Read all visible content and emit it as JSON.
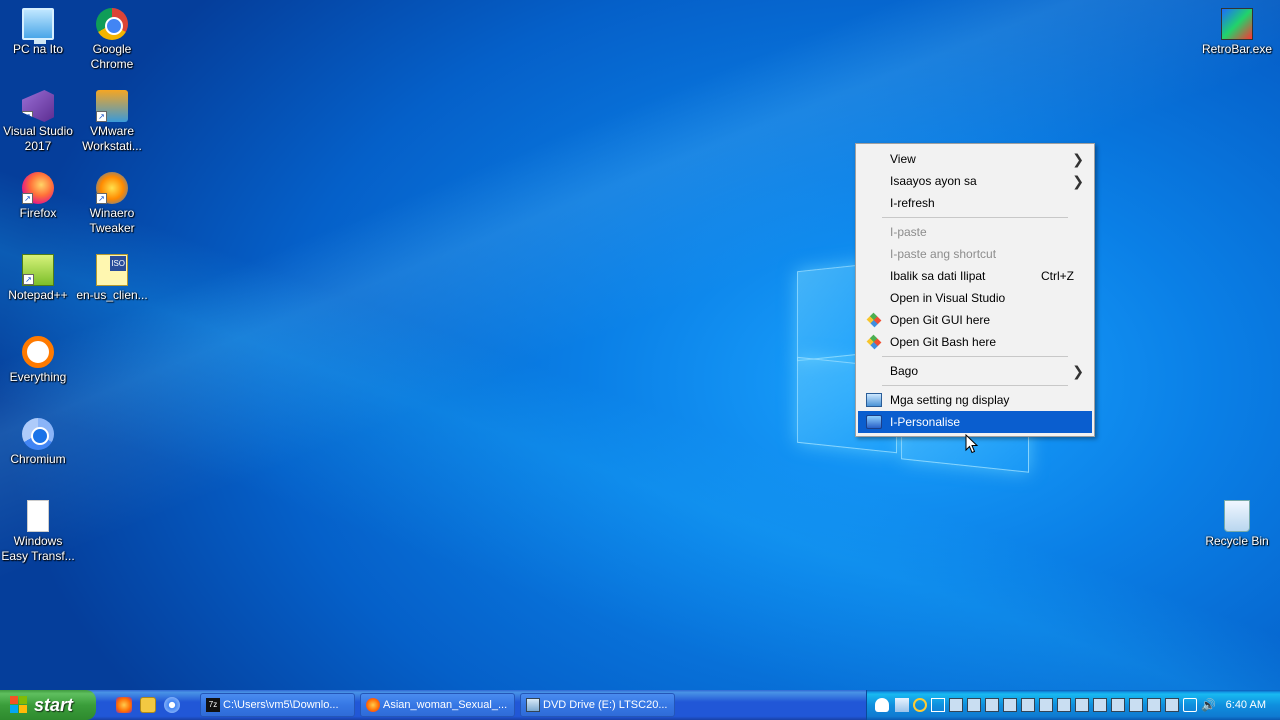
{
  "desktop": {
    "icons_left": [
      {
        "label": "PC na Ito",
        "icon": "computer-icon"
      },
      {
        "label": "Google Chrome",
        "icon": "chrome-icon"
      },
      {
        "label": "Visual Studio 2017",
        "icon": "visual-studio-icon"
      },
      {
        "label": "VMware Workstati...",
        "icon": "vmware-icon"
      },
      {
        "label": "Firefox",
        "icon": "firefox-icon"
      },
      {
        "label": "Winaero Tweaker",
        "icon": "winaero-icon"
      },
      {
        "label": "Notepad++",
        "icon": "notepadpp-icon"
      },
      {
        "label": "en-us_clien...",
        "icon": "iso-file-icon"
      },
      {
        "label": "Everything",
        "icon": "everything-icon"
      },
      {
        "label": "Chromium",
        "icon": "chromium-icon"
      },
      {
        "label": "Windows Easy Transf...",
        "icon": "file-icon"
      }
    ],
    "icons_right": [
      {
        "label": "RetroBar.exe",
        "icon": "retrobar-icon"
      },
      {
        "label": "Recycle Bin",
        "icon": "recycle-bin-icon"
      }
    ]
  },
  "context_menu": {
    "items": [
      {
        "label": "View",
        "submenu": true
      },
      {
        "label": "Isaayos ayon sa",
        "submenu": true
      },
      {
        "label": "I-refresh"
      },
      {
        "label": "I-paste",
        "disabled": true
      },
      {
        "label": "I-paste ang shortcut",
        "disabled": true
      },
      {
        "label": "Ibalik sa dati Ilipat",
        "shortcut": "Ctrl+Z"
      },
      {
        "label": "Open in Visual Studio"
      },
      {
        "label": "Open Git GUI here",
        "icon": "git-gui-icon"
      },
      {
        "label": "Open Git Bash here",
        "icon": "git-bash-icon"
      },
      {
        "label": "Bago",
        "submenu": true
      },
      {
        "label": "Mga setting ng display",
        "icon": "display-settings-icon"
      },
      {
        "label": "I-Personalise",
        "icon": "personalize-icon",
        "highlighted": true
      }
    ]
  },
  "taskbar": {
    "start_label": "start",
    "buttons": [
      {
        "label": "C:\\Users\\vm5\\Downlo...",
        "icon": "7zip-icon"
      },
      {
        "label": "Asian_woman_Sexual_...",
        "icon": "firefox-icon"
      },
      {
        "label": "DVD Drive (E:) LTSC20...",
        "icon": "dvd-drive-icon"
      }
    ],
    "clock": "6:40 AM"
  },
  "colors": {
    "menu_highlight": "#0a5ecf",
    "taskbar_blue": "#2157d7",
    "start_green": "#3a9d3a"
  }
}
